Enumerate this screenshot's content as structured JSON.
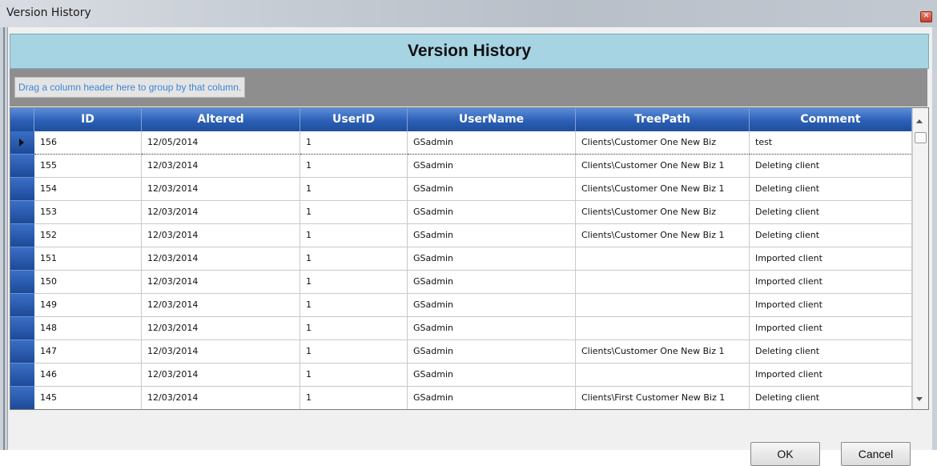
{
  "window": {
    "title": "Version History"
  },
  "heading": "Version History",
  "group_hint": "Drag a column header here to group by that column.",
  "columns": [
    "ID",
    "Altered",
    "UserID",
    "UserName",
    "TreePath",
    "Comment"
  ],
  "rows": [
    {
      "id": "156",
      "altered": "12/05/2014",
      "userid": "1",
      "username": "GSadmin",
      "treepath": "Clients\\Customer One New Biz",
      "comment": "test",
      "selected": true
    },
    {
      "id": "155",
      "altered": "12/03/2014",
      "userid": "1",
      "username": "GSadmin",
      "treepath": "Clients\\Customer One New Biz 1",
      "comment": "Deleting client"
    },
    {
      "id": "154",
      "altered": "12/03/2014",
      "userid": "1",
      "username": "GSadmin",
      "treepath": "Clients\\Customer One New Biz 1",
      "comment": "Deleting client"
    },
    {
      "id": "153",
      "altered": "12/03/2014",
      "userid": "1",
      "username": "GSadmin",
      "treepath": "Clients\\Customer One New Biz",
      "comment": "Deleting client"
    },
    {
      "id": "152",
      "altered": "12/03/2014",
      "userid": "1",
      "username": "GSadmin",
      "treepath": "Clients\\Customer One New Biz 1",
      "comment": "Deleting client"
    },
    {
      "id": "151",
      "altered": "12/03/2014",
      "userid": "1",
      "username": "GSadmin",
      "treepath": "",
      "comment": "Imported client"
    },
    {
      "id": "150",
      "altered": "12/03/2014",
      "userid": "1",
      "username": "GSadmin",
      "treepath": "",
      "comment": "Imported client"
    },
    {
      "id": "149",
      "altered": "12/03/2014",
      "userid": "1",
      "username": "GSadmin",
      "treepath": "",
      "comment": "Imported client"
    },
    {
      "id": "148",
      "altered": "12/03/2014",
      "userid": "1",
      "username": "GSadmin",
      "treepath": "",
      "comment": "Imported client"
    },
    {
      "id": "147",
      "altered": "12/03/2014",
      "userid": "1",
      "username": "GSadmin",
      "treepath": "Clients\\Customer One New Biz 1",
      "comment": "Deleting client"
    },
    {
      "id": "146",
      "altered": "12/03/2014",
      "userid": "1",
      "username": "GSadmin",
      "treepath": "",
      "comment": "Imported client"
    },
    {
      "id": "145",
      "altered": "12/03/2014",
      "userid": "1",
      "username": "GSadmin",
      "treepath": "Clients\\First Customer New Biz 1",
      "comment": "Deleting client"
    }
  ],
  "buttons": {
    "ok": "OK",
    "cancel": "Cancel"
  },
  "icons": {
    "close": "close-icon",
    "row_indicator": "current-row-arrow-icon"
  }
}
